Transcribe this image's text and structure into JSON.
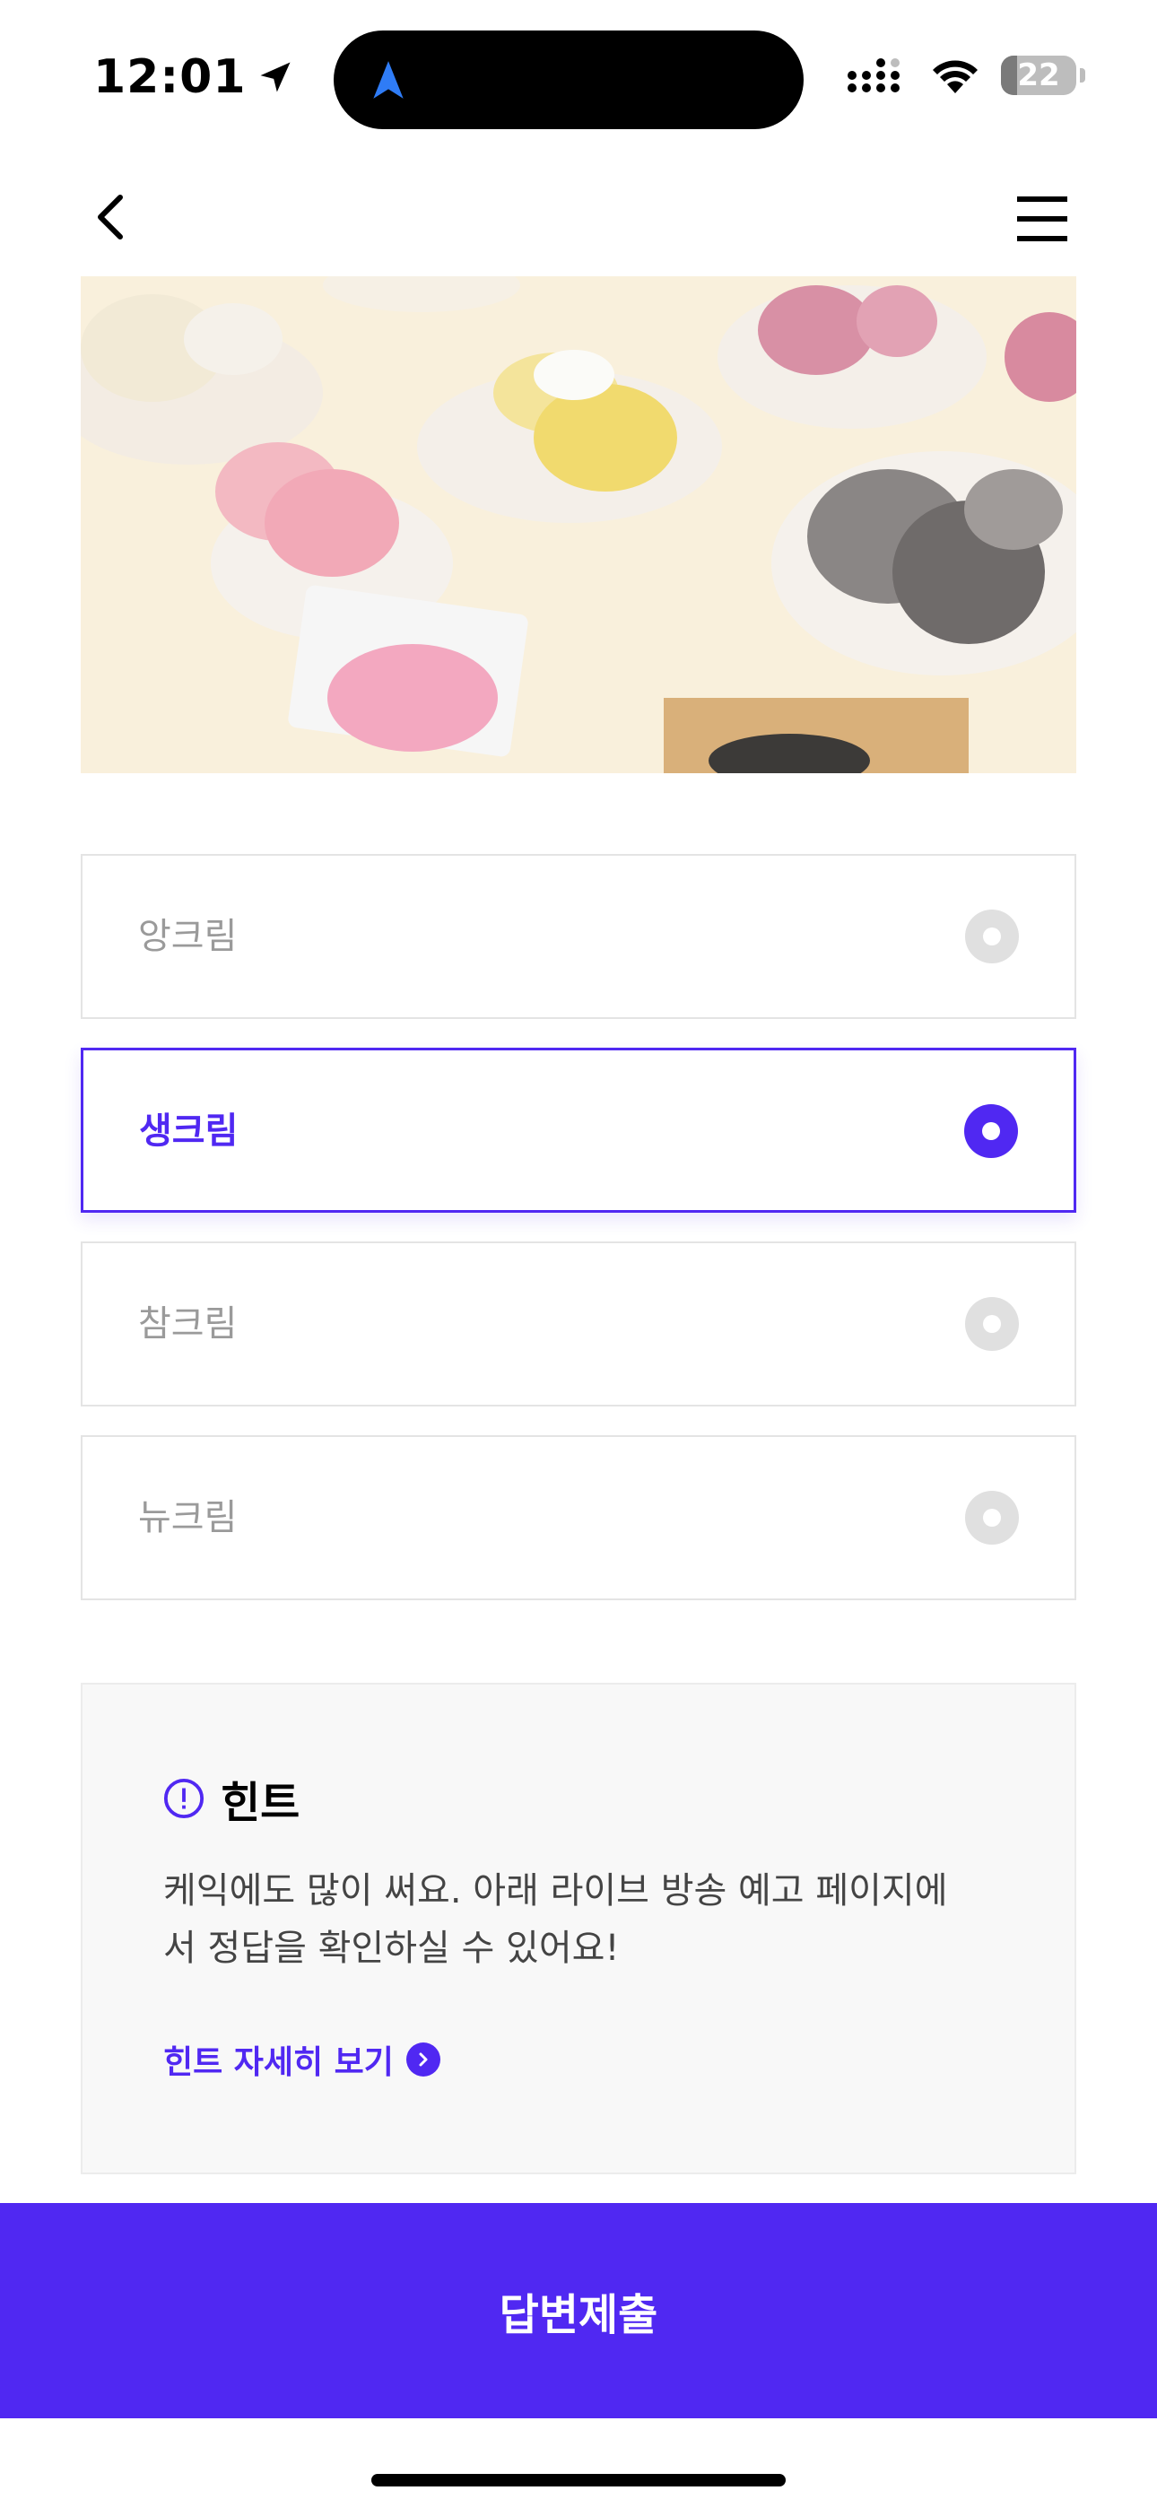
{
  "status_bar": {
    "time": "12:01",
    "battery_level": "22"
  },
  "nav": {
    "back_icon": "chevron-left-icon",
    "menu_icon": "hamburger-menu-icon"
  },
  "quiz": {
    "options": [
      {
        "label": "앙크림",
        "selected": false
      },
      {
        "label": "생크림",
        "selected": true
      },
      {
        "label": "참크림",
        "selected": false
      },
      {
        "label": "뉴크림",
        "selected": false
      }
    ]
  },
  "hint": {
    "title": "힌트",
    "text": "케익에도 많이 써요. 아래 라이브 방송 예고 페이지에서 정답을 확인하실 수 있어요!",
    "link_label": "힌트 자세히 보기"
  },
  "submit_label": "답변제출",
  "colors": {
    "accent": "#5028f2",
    "option_border": "#e4e4e4",
    "hint_bg": "#f8f8f8"
  }
}
